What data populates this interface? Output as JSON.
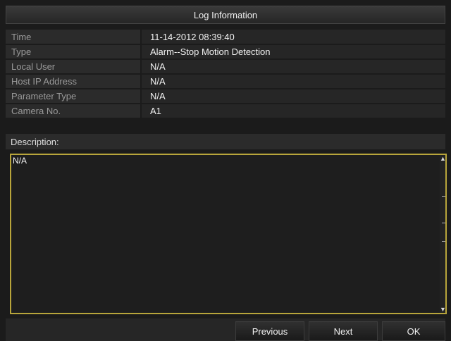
{
  "dialog": {
    "title": "Log Information",
    "rows": [
      {
        "label": "Time",
        "value": "11-14-2012 08:39:40"
      },
      {
        "label": "Type",
        "value": "Alarm--Stop Motion Detection"
      },
      {
        "label": "Local User",
        "value": "N/A"
      },
      {
        "label": "Host IP Address",
        "value": "N/A"
      },
      {
        "label": "Parameter Type",
        "value": "N/A"
      },
      {
        "label": "Camera No.",
        "value": "A1"
      }
    ],
    "description_label": "Description:",
    "description_text": "N/A"
  },
  "buttons": {
    "previous": "Previous",
    "next": "Next",
    "ok": "OK"
  },
  "icons": {
    "scroll_up": "scroll-up-arrow-icon",
    "scroll_down": "scroll-down-arrow-icon"
  },
  "colors": {
    "description_border": "#b8a53b",
    "background": "#1b1b1b"
  }
}
